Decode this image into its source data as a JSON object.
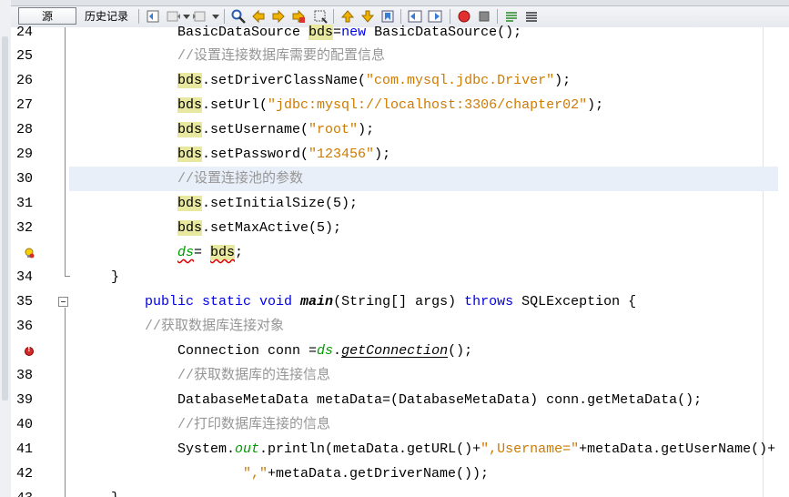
{
  "toolbar": {
    "source_tab": "源",
    "history_tab": "历史记录"
  },
  "editor": {
    "lines": [
      {
        "no": "24",
        "y": -6
      },
      {
        "no": "25"
      },
      {
        "no": "26"
      },
      {
        "no": "27"
      },
      {
        "no": "28"
      },
      {
        "no": "29"
      },
      {
        "no": "30"
      },
      {
        "no": "31"
      },
      {
        "no": "32"
      },
      {
        "no": ""
      },
      {
        "no": "34"
      },
      {
        "no": "35"
      },
      {
        "no": "36"
      },
      {
        "no": ""
      },
      {
        "no": "38"
      },
      {
        "no": "39"
      },
      {
        "no": "40"
      },
      {
        "no": "41"
      },
      {
        "no": "42"
      },
      {
        "no": "43"
      }
    ],
    "text": {
      "l24_a": "BasicDataSource ",
      "l24_b": "bds",
      "l24_c": "=",
      "l24_d": "new",
      "l24_e": " BasicDataSource();",
      "l25": "//设置连接数据库需要的配置信息",
      "bds": "bds",
      "l26_a": ".setDriverClassName(",
      "l26_s": "\"com.mysql.jdbc.Driver\"",
      "l26_e": ");",
      "l27_a": ".setUrl(",
      "l27_s": "\"jdbc:mysql://localhost:3306/chapter02\"",
      "l27_e": ");",
      "l28_a": ".setUsername(",
      "l28_s": "\"root\"",
      "l28_e": ");",
      "l29_a": ".setPassword(",
      "l29_s": "\"123456\"",
      "l29_e": ");",
      "l30": "//设置连接池的参数",
      "l31_a": ".setInitialSize(5);",
      "l32_a": ".setMaxActive(5);",
      "l33_ds": "ds",
      "l33_eq": "= ",
      "l33_semi": ";",
      "l34": "}",
      "l35_kw": "public static void",
      "l35_main": "main",
      "l35_args": "(String[] args) ",
      "l35_throws": "throws",
      "l35_rest": " SQLException {",
      "l36": "//获取数据库连接对象",
      "l37_a": "Connection conn =",
      "l37_ds": "ds",
      "l37_dot": ".",
      "l37_m": "getConnection",
      "l37_e": "();",
      "l38": "//获取数据库的连接信息",
      "l39": "DatabaseMetaData metaData=(DatabaseMetaData) conn.getMetaData();",
      "l40": "//打印数据库连接的信息",
      "l41_a": "System.",
      "l41_out": "out",
      "l41_b": ".println(metaData.getURL()+",
      "l41_s": "\",Username=\"",
      "l41_c": "+metaData.getUserName()+",
      "l42_s": "\",\"",
      "l42_c": "+metaData.getDriverName());",
      "l43": "}"
    }
  }
}
